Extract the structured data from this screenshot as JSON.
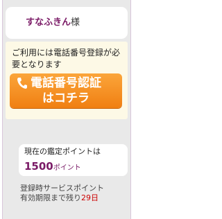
{
  "user": {
    "name": "すなふきん",
    "honorific": "様"
  },
  "phone_auth": {
    "notice": "ご利用には電話番号登録が必要となります",
    "button_line1": "電話番号認証",
    "button_line2": "はコチラ"
  },
  "points": {
    "label": "現在の鑑定ポイントは",
    "value": "1500",
    "unit": "ポイント"
  },
  "service_points": {
    "line1": "登録時サービスポイント",
    "line2_prefix": "有効期限まで残り",
    "days": "29",
    "days_unit": "日"
  },
  "colors": {
    "accent_purple": "#7a1a66",
    "button_orange": "#f0901f",
    "alert_red": "#cc0000"
  }
}
